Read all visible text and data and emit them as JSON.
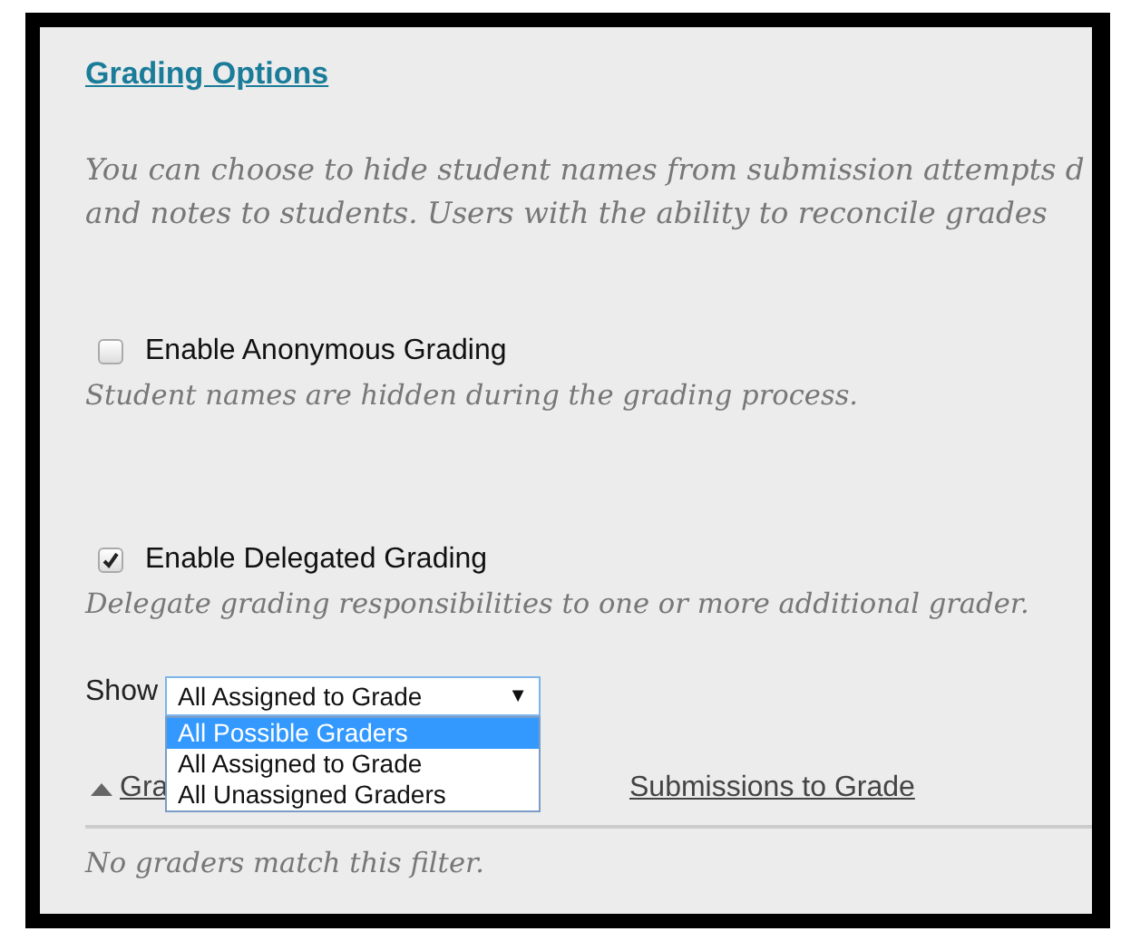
{
  "section": {
    "title": "Grading Options"
  },
  "intro": [
    "You can choose to hide student names from submission attempts d",
    "and notes to students. Users with the ability to reconcile grades"
  ],
  "options": [
    {
      "label": "Enable Anonymous Grading",
      "checked": false,
      "description": "Student names are hidden during the grading process."
    },
    {
      "label": "Enable Delegated Grading",
      "checked": true,
      "description": "Delegate grading responsibilities to one or more additional grader."
    }
  ],
  "filter": {
    "label": "Show",
    "value": "All Assigned to Grade",
    "caret": "▼",
    "expanded": true,
    "options": [
      {
        "label": "All Possible Graders",
        "highlighted": true
      },
      {
        "label": "All Assigned to Grade",
        "highlighted": false
      },
      {
        "label": "All Unassigned Graders",
        "highlighted": false
      }
    ]
  },
  "table": {
    "columns": [
      {
        "label": "Gra",
        "sorted": true
      },
      {
        "label": "Submissions to Grade",
        "sorted": false
      }
    ],
    "empty_message": "No graders match this filter."
  }
}
